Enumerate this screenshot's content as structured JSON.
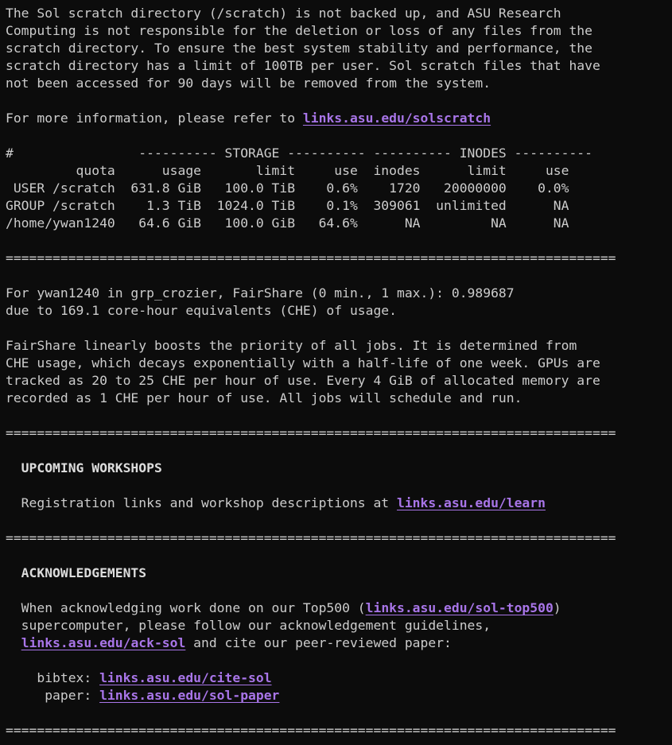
{
  "colors": {
    "background": "#0c0c0c",
    "text": "#cccccc",
    "link": "#a875e8"
  },
  "scratch_notice": [
    "The Sol scratch directory (/scratch) is not backed up, and ASU Research",
    "Computing is not responsible for the deletion or loss of any files from the",
    "scratch directory. To ensure the best system stability and performance, the",
    "scratch directory has a limit of 100TB per user. Sol scratch files that have",
    "not been accessed for 90 days will be removed from the system."
  ],
  "more_info": {
    "prefix": "For more information, please refer to ",
    "link": "links.asu.edu/solscratch"
  },
  "quota_table": {
    "group_header": "#                ---------- STORAGE ---------- ---------- INODES ----------",
    "column_header": "         quota      usage       limit     use  inodes      limit     use",
    "rows": [
      " USER /scratch  631.8 GiB   100.0 TiB    0.6%    1720   20000000    0.0%",
      "GROUP /scratch    1.3 TiB  1024.0 TiB    0.1%  309061  unlimited      NA",
      "/home/ywan1240   64.6 GiB   100.0 GiB   64.6%      NA         NA      NA"
    ]
  },
  "separator": "==============================================================================",
  "fairshare": [
    "For ywan1240 in grp_crozier, FairShare (0 min., 1 max.): 0.989687",
    "due to 169.1 core-hour equivalents (CHE) of usage."
  ],
  "fairshare_explain": [
    "FairShare linearly boosts the priority of all jobs. It is determined from",
    "CHE usage, which decays exponentially with a half-life of one week. GPUs are",
    "tracked as 20 to 25 CHE per hour of use. Every 4 GiB of allocated memory are",
    "recorded as 1 CHE per hour of use. All jobs will schedule and run."
  ],
  "workshops": {
    "heading": "  UPCOMING WORKSHOPS",
    "text_prefix": "  Registration links and workshop descriptions at ",
    "link": "links.asu.edu/learn"
  },
  "acknowledgements": {
    "heading": "  ACKNOWLEDGEMENTS",
    "line1_prefix": "  When acknowledging work done on our Top500 (",
    "line1_link": "links.asu.edu/sol-top500",
    "line1_suffix": ")",
    "line2": "  supercomputer, please follow our acknowledgement guidelines,",
    "line3_prefix": "  ",
    "line3_link": "links.asu.edu/ack-sol",
    "line3_suffix": " and cite our peer-reviewed paper:",
    "bibtex_label": "    bibtex: ",
    "bibtex_link": "links.asu.edu/cite-sol",
    "paper_label": "     paper: ",
    "paper_link": "links.asu.edu/sol-paper"
  }
}
